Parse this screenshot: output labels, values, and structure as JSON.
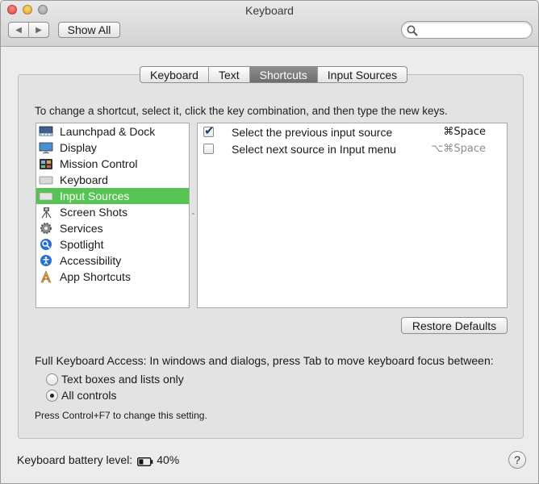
{
  "window": {
    "title": "Keyboard"
  },
  "toolbar": {
    "back_icon": "◀",
    "forward_icon": "▶",
    "show_all_label": "Show All",
    "search_placeholder": ""
  },
  "tabs": [
    {
      "label": "Keyboard",
      "active": false
    },
    {
      "label": "Text",
      "active": false
    },
    {
      "label": "Shortcuts",
      "active": true
    },
    {
      "label": "Input Sources",
      "active": false
    }
  ],
  "instruction": "To change a shortcut, select it, click the key combination, and then type the new keys.",
  "categories": [
    {
      "label": "Launchpad & Dock",
      "icon": "launchpad-dock-icon"
    },
    {
      "label": "Display",
      "icon": "display-icon"
    },
    {
      "label": "Mission Control",
      "icon": "mission-control-icon"
    },
    {
      "label": "Keyboard",
      "icon": "keyboard-icon"
    },
    {
      "label": "Input Sources",
      "icon": "input-sources-icon",
      "selected": true
    },
    {
      "label": "Screen Shots",
      "icon": "screen-shots-icon"
    },
    {
      "label": "Services",
      "icon": "services-gear-icon"
    },
    {
      "label": "Spotlight",
      "icon": "spotlight-icon"
    },
    {
      "label": "Accessibility",
      "icon": "accessibility-icon"
    },
    {
      "label": "App Shortcuts",
      "icon": "app-shortcuts-icon"
    }
  ],
  "shortcuts": [
    {
      "label": "Select the previous input source",
      "key": "⌘Space",
      "checked": true
    },
    {
      "label": "Select next source in Input menu",
      "key": "⌥⌘Space",
      "checked": false
    }
  ],
  "restore_defaults_label": "Restore Defaults",
  "full_keyboard_access": {
    "label": "Full Keyboard Access: In windows and dialogs, press Tab to move keyboard focus between:",
    "options": [
      {
        "label": "Text boxes and lists only",
        "selected": false
      },
      {
        "label": "All controls",
        "selected": true
      }
    ],
    "hint": "Press Control+F7 to change this setting."
  },
  "battery": {
    "label": "Keyboard battery level:",
    "value": "40%",
    "level": 0.4
  },
  "help_label": "?",
  "colors": {
    "selection": "#56c453",
    "active_tab": "#7b7b7b"
  }
}
